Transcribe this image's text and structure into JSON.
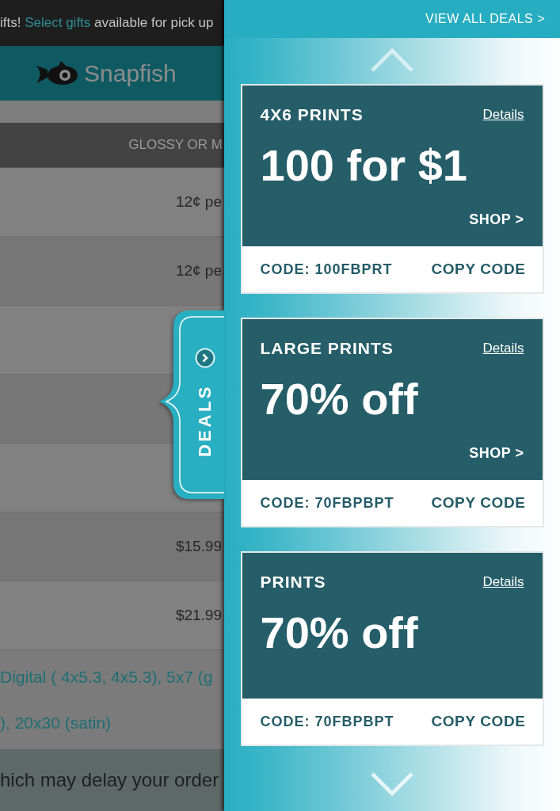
{
  "promo_bar": {
    "text_before": "ifts!",
    "link": "Select gifts",
    "text_after": "available for pick up"
  },
  "site_header": {
    "logo_text": "Snapfish"
  },
  "table": {
    "columns": [
      "GLOSSY OR M"
    ],
    "rows": [
      {
        "cell": "12¢ pe"
      },
      {
        "cell": "12¢ pe"
      },
      {},
      {},
      {},
      {
        "cell": "$15.99"
      },
      {
        "cell": "$21.99"
      }
    ]
  },
  "size_list": [
    "Digital ( 4x5.3, 4x5.3), 5x7 (g",
    "), 20x30 (satin)"
  ],
  "notice": "hich may delay your order",
  "deals_tab": {
    "label": "DEALS"
  },
  "deals_panel": {
    "view_all_link": "VIEW ALL DEALS >",
    "deals": [
      {
        "category": "4X6 PRINTS",
        "details_link": "Details",
        "offer": "100 for $1",
        "shop_link": "SHOP >",
        "code": "CODE: 100FBPRT",
        "copy_button": "COPY CODE"
      },
      {
        "category": "LARGE PRINTS",
        "details_link": "Details",
        "offer": "70% off",
        "shop_link": "SHOP >",
        "code": "CODE: 70FBPBPT",
        "copy_button": "COPY CODE"
      },
      {
        "category": "PRINTS",
        "details_link": "Details",
        "offer": "70% off",
        "code": "CODE: 70FBPBPT",
        "copy_button": "COPY CODE"
      }
    ]
  }
}
